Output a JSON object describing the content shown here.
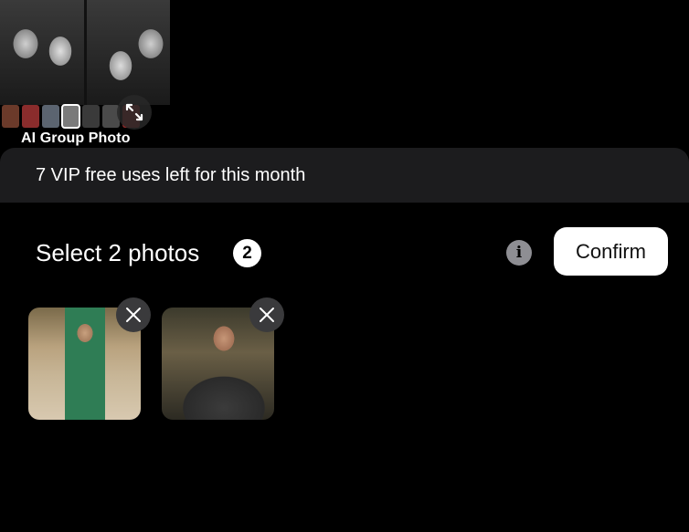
{
  "preview": {
    "title": "AI Group Photo",
    "strip_colors": [
      "#6b3a2a",
      "#8a2c2c",
      "#5b6470",
      "#7a7a7a",
      "#3a3a3a",
      "#4a4a4a",
      "#9c2a2a"
    ],
    "selected_thumb_index": 3
  },
  "banner": {
    "text": "7 VIP free uses left for this month"
  },
  "selection": {
    "title": "Select 2 photos",
    "count": "2",
    "info_icon": "info-icon",
    "confirm_label": "Confirm"
  },
  "photos": [
    {
      "name": "photo-woman-green-dress",
      "remove_icon": "close-icon"
    },
    {
      "name": "photo-man-dark-sweater",
      "remove_icon": "close-icon"
    }
  ]
}
